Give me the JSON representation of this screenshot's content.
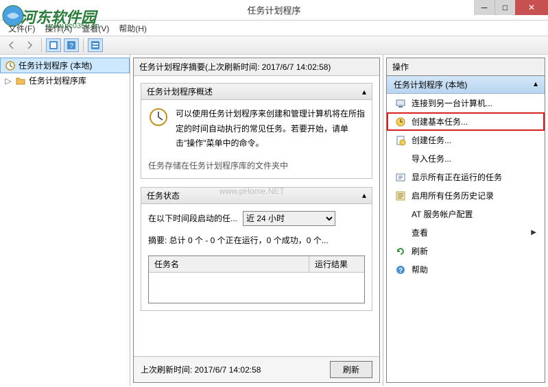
{
  "window": {
    "title": "任务计划程序"
  },
  "watermarks": {
    "brand": "河东软件园",
    "url": "www.pc0359.cn",
    "center": "www.pHome.NET"
  },
  "menubar": {
    "file": "文件(F)",
    "action": "操作(A)",
    "view": "查看(V)",
    "help": "帮助(H)"
  },
  "tree": {
    "root": "任务计划程序 (本地)",
    "lib": "任务计划程序库"
  },
  "center": {
    "header": "任务计划程序摘要(上次刷新时间: 2017/6/7 14:02:58)",
    "overview_title": "任务计划程序概述",
    "overview_text": "可以使用任务计划程序来创建和管理计算机将在所指定的时间自动执行的常见任务。若要开始，请单击\"操作\"菜单中的命令。",
    "overview_sub": "任务存储在任务计划程序库的文件夹中",
    "status_title": "任务状态",
    "status_label": "在以下时间段启动的任...",
    "status_select": "近 24 小时",
    "summary": "摘要: 总计 0 个 - 0 个正在运行，0 个成功，0 个...",
    "col_name": "任务名",
    "col_result": "运行结果",
    "footer_time": "上次刷新时间: 2017/6/7 14:02:58",
    "refresh_btn": "刷新"
  },
  "actions": {
    "header": "操作",
    "group": "任务计划程序 (本地)",
    "items": [
      "连接到另一台计算机...",
      "创建基本任务...",
      "创建任务...",
      "导入任务...",
      "显示所有正在运行的任务",
      "启用所有任务历史记录",
      "AT 服务帐户配置",
      "查看",
      "刷新",
      "帮助"
    ]
  }
}
